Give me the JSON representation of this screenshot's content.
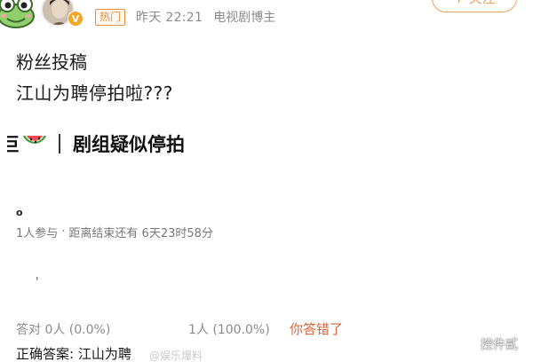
{
  "header": {
    "hot_tag": "热门",
    "time": "昨天 22:21",
    "role": "电视剧博主",
    "follow_label": "+ 关注",
    "verified_badge": "V"
  },
  "post": {
    "line1": "粉丝投稿",
    "line2": "江山为聘停拍啦???"
  },
  "vote": {
    "title_prefix": "宇宙巨",
    "title": "剧组疑似停拍",
    "small_mark": "o",
    "participants": "1人参与",
    "dot": "·",
    "deadline": "距离结束还有 6天23时58分",
    "stray_mark": "'",
    "result_left": "答对 0人 (0.0%)",
    "result_right": "1人 (100.0%)",
    "result_status": "你答错了",
    "correct_answer": "正确答案: 江山为聘"
  },
  "watermarks": {
    "small": "@娱乐爆料",
    "brand": "控件貳"
  },
  "colors": {
    "accent": "#e88f3f",
    "wrong": "#d8663a",
    "muted": "#8a8a8a"
  },
  "icons": [
    "frog-avatar-icon",
    "verified-icon",
    "watermelon-icon",
    "clock-icon",
    "brand-logo-icon"
  ]
}
